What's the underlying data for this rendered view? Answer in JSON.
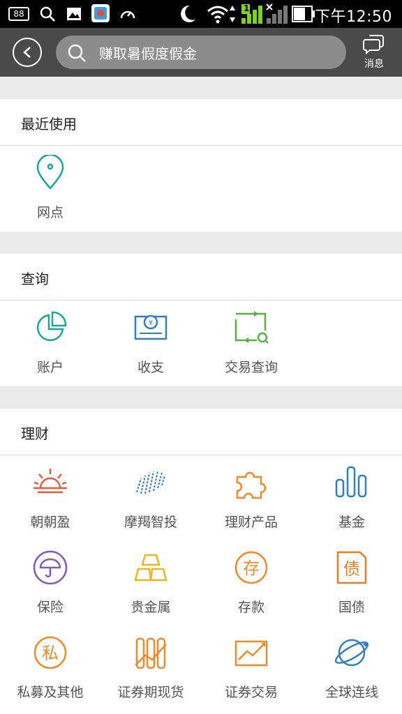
{
  "status_bar": {
    "notification_count": "88",
    "time": "下午12:50",
    "signal_badge": "1"
  },
  "header": {
    "search_text": "赚取暑假度假金",
    "message_label": "消息"
  },
  "sections": [
    {
      "title": "最近使用",
      "items": [
        {
          "label": "网点",
          "icon": "location-pin-icon"
        }
      ]
    },
    {
      "title": "查询",
      "items": [
        {
          "label": "账户",
          "icon": "pie-chart-icon"
        },
        {
          "label": "收支",
          "icon": "bill-yuan-icon"
        },
        {
          "label": "交易查询",
          "icon": "transaction-search-icon"
        }
      ]
    },
    {
      "title": "理财",
      "items": [
        {
          "label": "朝朝盈",
          "icon": "sunrise-icon"
        },
        {
          "label": "摩羯智投",
          "icon": "capricorn-lines-icon"
        },
        {
          "label": "理财产品",
          "icon": "puzzle-icon"
        },
        {
          "label": "基金",
          "icon": "bar-chart-icon"
        },
        {
          "label": "保险",
          "icon": "umbrella-icon"
        },
        {
          "label": "贵金属",
          "icon": "gold-bars-icon"
        },
        {
          "label": "存款",
          "icon": "deposit-icon"
        },
        {
          "label": "国债",
          "icon": "bond-icon"
        },
        {
          "label": "私募及其他",
          "icon": "private-icon"
        },
        {
          "label": "证券期现货",
          "icon": "futures-icon"
        },
        {
          "label": "证券交易",
          "icon": "stock-trend-icon"
        },
        {
          "label": "全球连线",
          "icon": "globe-icon"
        }
      ]
    }
  ],
  "colors": {
    "teal": "#1aa59a",
    "blue": "#2f7fc7",
    "green": "#56b043",
    "red": "#e65a3c",
    "orange": "#f08a2a",
    "purple": "#7e5bc2",
    "gold": "#f0b323"
  }
}
